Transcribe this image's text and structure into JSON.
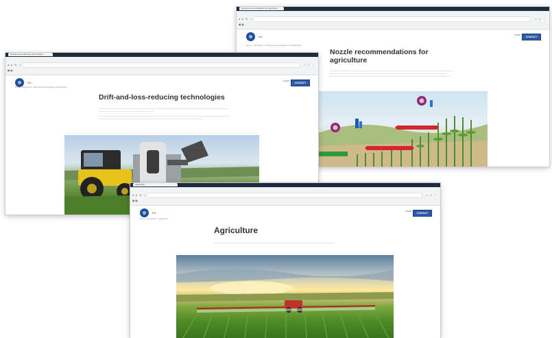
{
  "windows": {
    "drift": {
      "tab_title": "Drift-and-loss-reducing technologies",
      "breadcrumb": "Home › Agriculture › Drift-and-loss-reducing technologies",
      "title": "Drift-and-loss-reducing technologies",
      "lang": "EN",
      "button": "CONTACT",
      "login": "LOGIN"
    },
    "nozzle": {
      "tab_title": "Nozzle recommendations for agriculture",
      "breadcrumb": "Home › Agriculture › Nozzle recommendations for agriculture",
      "title": "Nozzle recommendations for agriculture",
      "lang": "EN",
      "button": "CONTACT",
      "login": "LOGIN"
    },
    "agriculture": {
      "tab_title": "Agriculture",
      "breadcrumb": "Home › Industries › Agriculture",
      "title": "Agriculture",
      "lang": "EN",
      "button": "CONTACT",
      "login": "LOGIN"
    }
  },
  "colors": {
    "brand_blue": "#1c4f9c",
    "chrome_dark": "#1f2b3d",
    "green_label": "#2c9a3a",
    "red_label": "#d3262e"
  }
}
